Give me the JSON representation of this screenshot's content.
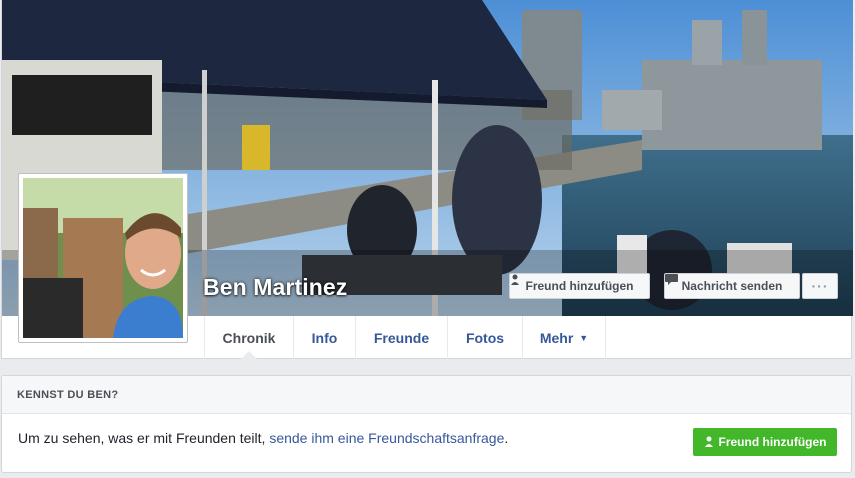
{
  "profile": {
    "name": "Ben Martinez"
  },
  "cover_actions": {
    "add_friend": "Freund hinzufügen",
    "send_message": "Nachricht senden",
    "more": "···"
  },
  "tabs": [
    {
      "label": "Chronik",
      "active": true
    },
    {
      "label": "Info"
    },
    {
      "label": "Freunde"
    },
    {
      "label": "Fotos"
    },
    {
      "label": "Mehr"
    }
  ],
  "know_box": {
    "heading": "KENNST DU BEN?",
    "text_prefix": "Um zu sehen, was er mit Freunden teilt, ",
    "link": "sende ihm eine Freundschaftsanfrage",
    "text_suffix": ".",
    "button": "Freund hinzufügen"
  },
  "icons": {
    "add_friend": "add-person-icon",
    "message": "message-icon",
    "dropdown": "caret-down-icon"
  },
  "colors": {
    "link": "#365899",
    "green_button": "#42b72a",
    "page_bg": "#e9ebee"
  }
}
